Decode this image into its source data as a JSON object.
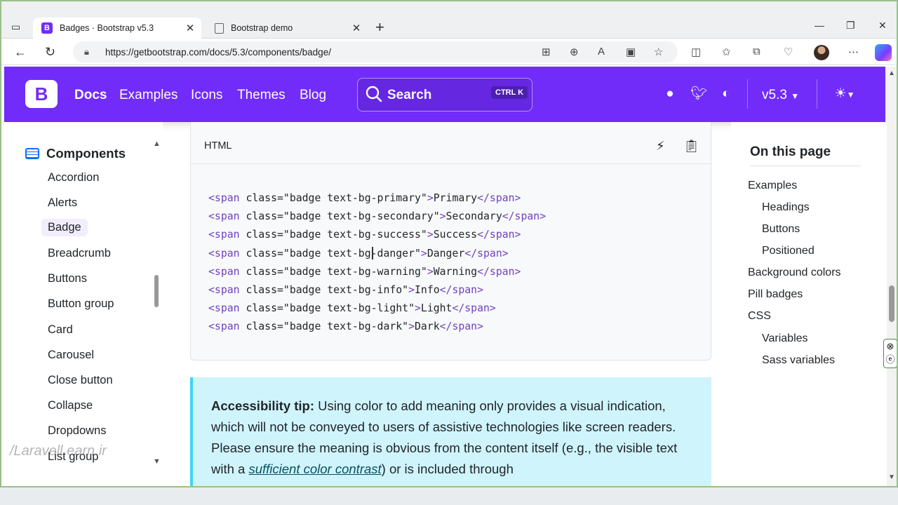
{
  "browser": {
    "tabs": [
      {
        "title": "Badges · Bootstrap v5.3",
        "active": true
      },
      {
        "title": "Bootstrap demo",
        "active": false
      }
    ],
    "url": "https://getbootstrap.com/docs/5.3/components/badge/"
  },
  "header": {
    "logo": "B",
    "links": [
      "Docs",
      "Examples",
      "Icons",
      "Themes",
      "Blog"
    ],
    "search_label": "Search",
    "search_shortcut": "CTRL K",
    "version": "v5.3"
  },
  "sidebar": {
    "section": "Components",
    "items": [
      "Accordion",
      "Alerts",
      "Badge",
      "Breadcrumb",
      "Buttons",
      "Button group",
      "Card",
      "Carousel",
      "Close button",
      "Collapse",
      "Dropdowns",
      "List group"
    ],
    "active_item": "Badge",
    "watermark": "/Laravell.earn.ir"
  },
  "code": {
    "lang": "HTML",
    "lines": [
      "<span class=\"badge text-bg-primary\">Primary</span>",
      "<span class=\"badge text-bg-secondary\">Secondary</span>",
      "<span class=\"badge text-bg-success\">Success</span>",
      "<span class=\"badge text-bg-danger\">Danger</span>",
      "<span class=\"badge text-bg-warning\">Warning</span>",
      "<span class=\"badge text-bg-info\">Info</span>",
      "<span class=\"badge text-bg-light\">Light</span>",
      "<span class=\"badge text-bg-dark\">Dark</span>"
    ]
  },
  "callout": {
    "heading": "Accessibility tip:",
    "text_1": " Using color to add meaning only provides a visual indication, which will not be conveyed to users of assistive technologies like screen readers. Please ensure the meaning is obvious from the content itself (e.g., the visible text with a ",
    "link": "sufficient color contrast",
    "text_2": ") or is included through"
  },
  "toc": {
    "title": "On this page",
    "items": [
      {
        "label": "Examples",
        "level": 1
      },
      {
        "label": "Headings",
        "level": 2
      },
      {
        "label": "Buttons",
        "level": 2
      },
      {
        "label": "Positioned",
        "level": 2
      },
      {
        "label": "Background colors",
        "level": 1
      },
      {
        "label": "Pill badges",
        "level": 1
      },
      {
        "label": "CSS",
        "level": 1
      },
      {
        "label": "Variables",
        "level": 2
      },
      {
        "label": "Sass variables",
        "level": 2
      }
    ]
  },
  "colors": {
    "brand": "#712cf9",
    "callout_bg": "#cff4fc",
    "callout_border": "#3dd5f3"
  }
}
